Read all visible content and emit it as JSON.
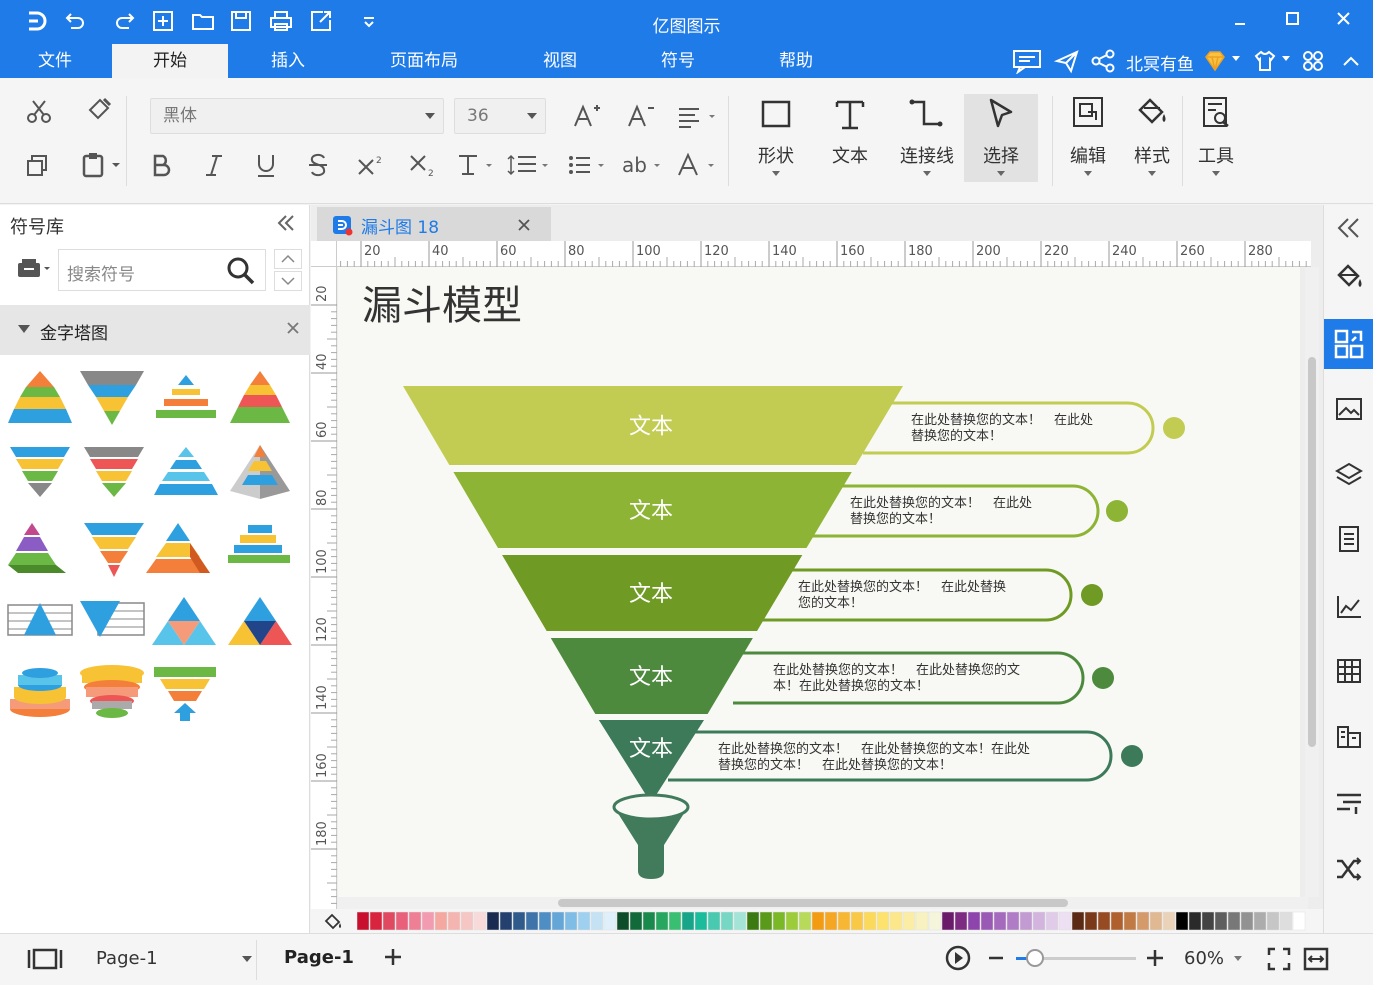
{
  "app": {
    "title": "亿图图示"
  },
  "menu": {
    "items": [
      {
        "label": "文件"
      },
      {
        "label": "开始"
      },
      {
        "label": "插入"
      },
      {
        "label": "页面布局"
      },
      {
        "label": "视图"
      },
      {
        "label": "符号"
      },
      {
        "label": "帮助"
      }
    ],
    "active": "开始",
    "user": "北冥有鱼"
  },
  "ribbon": {
    "font_name": "黑体",
    "font_size": "36",
    "tools": [
      {
        "label": "形状"
      },
      {
        "label": "文本"
      },
      {
        "label": "连接线"
      },
      {
        "label": "选择"
      },
      {
        "label": "编辑"
      },
      {
        "label": "样式"
      },
      {
        "label": "工具"
      }
    ]
  },
  "sidebar": {
    "title": "符号库",
    "search_placeholder": "搜索符号",
    "category": "金字塔图"
  },
  "doc_tab": {
    "label": "漏斗图 18"
  },
  "ruler": {
    "h_ticks": [
      "20",
      "40",
      "60",
      "80",
      "100",
      "120",
      "140",
      "160",
      "180",
      "200",
      "220",
      "240",
      "260",
      "280"
    ],
    "v_ticks": [
      "20",
      "40",
      "60",
      "80",
      "100",
      "120",
      "140",
      "160",
      "180"
    ]
  },
  "diagram": {
    "title": "漏斗模型",
    "levels": [
      {
        "label": "文本",
        "color": "#c2cc52",
        "desc1": "在此处替换您的文本！　在此处",
        "desc2": "替换您的文本！"
      },
      {
        "label": "文本",
        "color": "#8db434",
        "desc1": "在此处替换您的文本！　在此处",
        "desc2": "替换您的文本！"
      },
      {
        "label": "文本",
        "color": "#6f9a24",
        "desc1": "在此处替换您的文本！　在此处替换",
        "desc2": "您的文本！"
      },
      {
        "label": "文本",
        "color": "#4e8a3e",
        "desc1": "在此处替换您的文本！　在此处替换您的文",
        "desc2": "本！在此处替换您的文本！"
      },
      {
        "label": "文本",
        "color": "#3d7a5a",
        "desc1": "在此处替换您的文本！　在此处替换您的文本！在此处",
        "desc2": "替换您的文本！　在此处替换您的文本！"
      }
    ],
    "spout_color": "#427a5c"
  },
  "status": {
    "page_select": "Page-1",
    "page_tab": "Page-1",
    "zoom": "60%"
  }
}
